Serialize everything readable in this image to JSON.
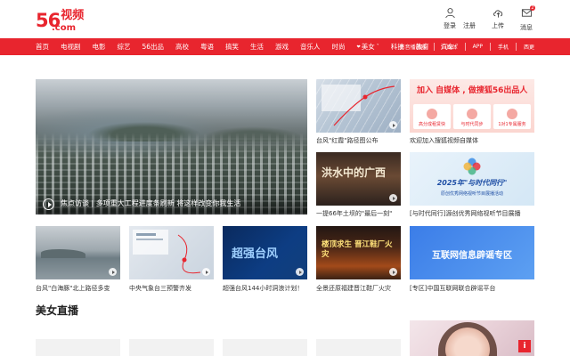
{
  "logo": {
    "num": "56",
    "cn": "视频",
    "dotcom": ".com"
  },
  "header": {
    "login": "登录",
    "register": "注册",
    "upload": "上传",
    "messages": "消息",
    "msg_badge": "2"
  },
  "nav": {
    "items": [
      "首页",
      "电视剧",
      "电影",
      "综艺",
      "56出品",
      "高校",
      "粤语",
      "搞笑",
      "生活",
      "游戏",
      "音乐人",
      "时尚",
      "美女",
      "科技",
      "教育",
      "汽车"
    ],
    "right": [
      "影音播放器",
      "自媒体",
      "APP",
      "手机",
      "西更"
    ]
  },
  "hero": {
    "caption": "焦点访谈 | 多项重大工程进度条刷新 将这样改变你我生活"
  },
  "tiles": {
    "typhoon_route": {
      "caption": "台风\"红霞\"路径图公布"
    },
    "ad": {
      "caption": "欢迎加入搜狐视频自媒体",
      "headline": "加入 自媒体 , 做搜狐56出品人",
      "left_badge": "高分成租赁快",
      "mid_badge": "与时代同步",
      "right_badge": "1对1专属服务"
    },
    "flood": {
      "caption": "一提66年土坝的\"最后一刻\"",
      "overlay": "洪水中的广西"
    },
    "forum": {
      "caption": "[与时代同行]源创优秀网络视听节目展播",
      "overlay": "2025年\"与时代同行\"",
      "sub": "原创优秀网络视听节目展播活动"
    },
    "sea": {
      "caption": "台风\"白海豚\"北上路径多变"
    },
    "map2": {
      "caption": "中央气象台三预警齐发"
    },
    "news": {
      "caption": "超强台风144小时洞浪计划！",
      "overlay": "超强台风"
    },
    "fire": {
      "caption": "全景还原福建晋江鞋厂火灾",
      "overlay": "楼顶求生 晋江鞋厂火灾"
    },
    "blue": {
      "caption": "[专区]中国互联网联合辟谣平台",
      "overlay": "互联网信息辟谣专区"
    }
  },
  "section": {
    "title": "美女直播"
  },
  "colors": {
    "brand": "#e8252e",
    "nav_bg": "#e8252e"
  }
}
